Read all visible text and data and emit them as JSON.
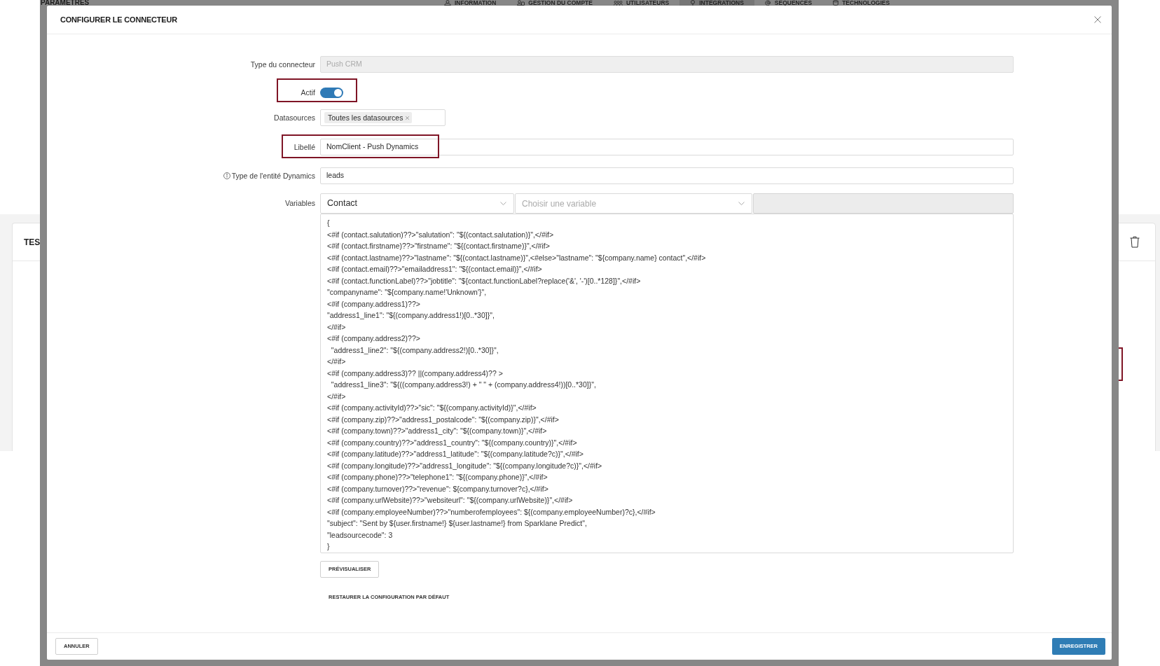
{
  "background_page": {
    "title": "PARAMETRES",
    "tabs": [
      {
        "label": "INFORMATION",
        "selected": false
      },
      {
        "label": "GESTION DU COMPTE",
        "selected": false
      },
      {
        "label": "UTILISATEURS",
        "selected": false
      },
      {
        "label": "INTEGRATIONS",
        "selected": true
      },
      {
        "label": "SEQUENCES",
        "selected": false
      },
      {
        "label": "TECHNOLOGIES",
        "selected": false
      }
    ],
    "left_card": {
      "title": "TES"
    }
  },
  "dialog": {
    "title": "CONFIGURER LE CONNECTEUR",
    "rows": [
      {
        "kind": "text",
        "label": "Type du connecteur",
        "value": "Push CRM",
        "disabled": true,
        "highlighted": false
      },
      {
        "kind": "toggle",
        "label": "Actif",
        "on": true,
        "highlighted": true
      },
      {
        "kind": "tags",
        "label": "Datasources",
        "tags": [
          "Toutes les datasources"
        ],
        "highlighted": false
      },
      {
        "kind": "text",
        "label": "Libellé",
        "value": "NomClient - Push Dynamics",
        "disabled": false,
        "highlighted": true
      },
      {
        "kind": "text",
        "label": "Type de l'entité Dynamics",
        "info": true,
        "value": "leads",
        "disabled": false,
        "highlighted": false
      },
      {
        "kind": "variables",
        "label": "Variables",
        "selects": [
          {
            "value": "Contact"
          },
          {
            "placeholder": "Choisir une variable"
          }
        ],
        "extra_field": {
          "disabled": true
        },
        "highlighted": false,
        "template": [
          "{",
          "<#if (contact.salutation)??>\"salutation\": \"${(contact.salutation)}\",</#if>",
          "<#if (contact.firstname)??>\"firstname\": \"${(contact.firstname)}\",</#if>",
          "<#if (contact.lastname)??>\"lastname\": \"${(contact.lastname)}\",<#else>\"lastname\": \"${company.name} contact\",</#if>",
          "<#if (contact.email)??>\"emailaddress1\": \"${(contact.email)}\",</#if>",
          "<#if (contact.functionLabel)??>\"jobtitle\": \"${contact.functionLabel?replace('&', '-')[0..*128]}\",</#if>",
          "\"companyname\": \"${company.name!'Unknown'}\",",
          "<#if (company.address1)??>",
          "\"address1_line1\": \"${(company.address1!)[0..*30]}\",",
          "</#if>",
          "<#if (company.address2)??>",
          "  \"address1_line2\": \"${(company.address2!)[0..*30]}\",",
          "</#if>",
          "<#if (company.address3)?? ||(company.address4)?? >",
          "  \"address1_line3\": \"${((company.address3!) + \" \" + (company.address4!))[0..*30]}\",",
          "</#if>",
          "<#if (company.activityId)??>\"sic\": \"${(company.activityId)}\",</#if>",
          "<#if (company.zip)??>\"address1_postalcode\": \"${(company.zip)}\",</#if>",
          "<#if (company.town)??>\"address1_city\": \"${(company.town)}\",</#if>",
          "<#if (company.country)??>\"address1_country\": \"${(company.country)}\",</#if>",
          "<#if (company.latitude)??>\"address1_latitude\": \"${(company.latitude?c)}\",</#if>",
          "<#if (company.longitude)??>\"address1_longitude\": \"${(company.longitude?c)}\",</#if>",
          "<#if (company.phone)??>\"telephone1\": \"${(company.phone)}\",</#if>",
          "<#if (company.turnover)??>\"revenue\": ${company.turnover?c},</#if>",
          "<#if (company.urlWebsite)??>\"websiteurl\": \"${(company.urlWebsite)}\",</#if>",
          "<#if (company.employeeNumber)??>\"numberofemployees\": ${(company.employeeNumber)?c},</#if>",
          "\"subject\": \"Sent by ${user.firstname!} ${user.lastname!} from Sparklane Predict\",",
          "\"leadsourcecode\": 3",
          "}"
        ]
      }
    ],
    "preview_button": "PRÉVISUALISER",
    "restore_button": "RESTAURER LA CONFIGURATION PAR DÉFAUT",
    "footer_buttons": [
      {
        "label": "ANNULER",
        "kind": "secondary"
      },
      {
        "label": "ENREGISTRER",
        "kind": "primary"
      }
    ]
  }
}
